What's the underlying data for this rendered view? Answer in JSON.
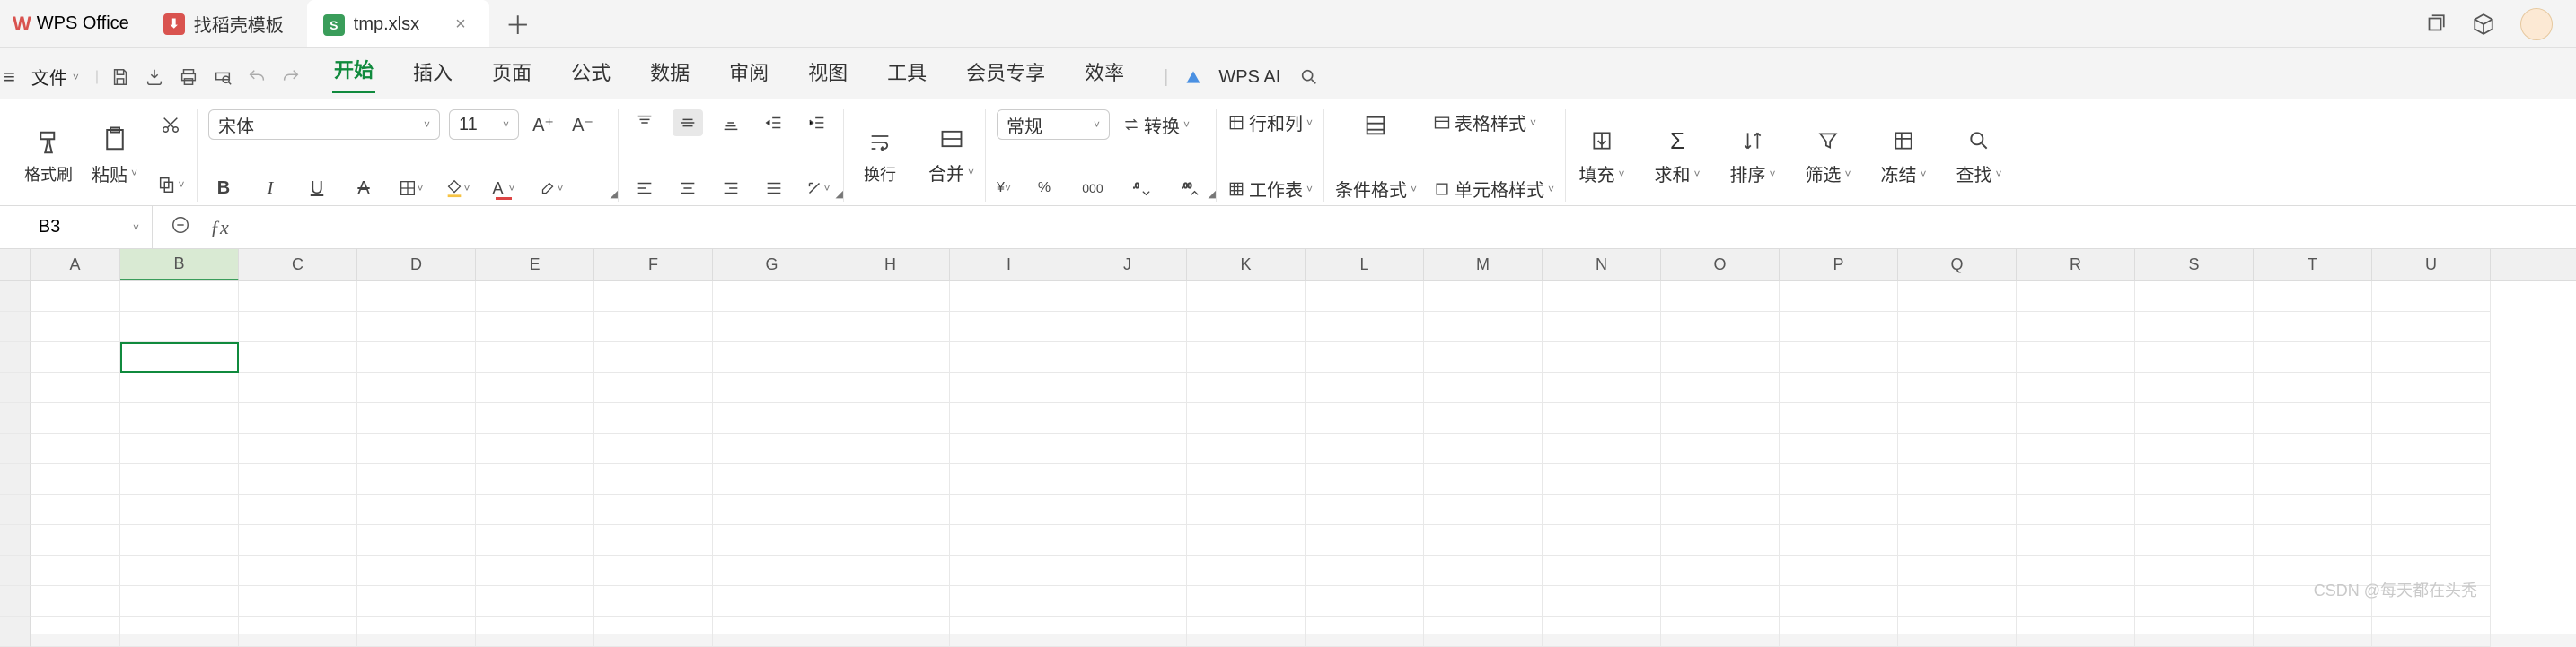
{
  "app": {
    "name": "WPS Office"
  },
  "tabs": {
    "template": "找稻壳模板",
    "file": "tmp.xlsx"
  },
  "menubar": {
    "file": "文件",
    "items": [
      "开始",
      "插入",
      "页面",
      "公式",
      "数据",
      "审阅",
      "视图",
      "工具",
      "会员专享",
      "效率"
    ],
    "active_index": 0,
    "ai": "WPS AI"
  },
  "ribbon": {
    "format_painter": "格式刷",
    "paste": "粘贴",
    "font": {
      "name": "宋体",
      "size": "11"
    },
    "wrap": "换行",
    "merge": "合并",
    "number_format": "常规",
    "convert": "转换",
    "rowcol": "行和列",
    "sheet": "工作表",
    "conditional": "条件格式",
    "cell_style": "单元格样式",
    "table_style": "表格样式",
    "fill": "填充",
    "sum": "求和",
    "sort": "排序",
    "filter": "筛选",
    "freeze": "冻结",
    "find": "查找"
  },
  "namebox": {
    "ref": "B3"
  },
  "columns": [
    "A",
    "B",
    "C",
    "D",
    "E",
    "F",
    "G",
    "H",
    "I",
    "J",
    "K",
    "L",
    "M",
    "N",
    "O",
    "P",
    "Q",
    "R",
    "S",
    "T",
    "U"
  ],
  "watermark": "CSDN @每天都在头秃",
  "selected_col_index": 1,
  "selected_row_index": 2
}
